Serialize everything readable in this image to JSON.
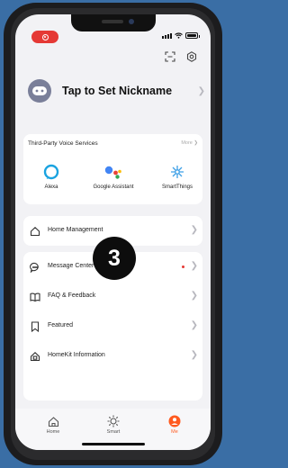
{
  "profile": {
    "nickname": "Tap to Set Nickname"
  },
  "voice": {
    "title": "Third-Party Voice Services",
    "more": "More",
    "services": [
      {
        "label": "Alexa",
        "icon": "alexa-icon"
      },
      {
        "label": "Google Assistant",
        "icon": "google-assistant-icon"
      },
      {
        "label": "SmartThings",
        "icon": "smartthings-icon"
      }
    ]
  },
  "menu": {
    "home_management": "Home Management",
    "message_center": "Message Center",
    "faq": "FAQ & Feedback",
    "featured": "Featured",
    "homekit": "HomeKit Information"
  },
  "step_badge": "3",
  "tabs": [
    {
      "label": "Home",
      "icon": "home-icon",
      "active": false
    },
    {
      "label": "Smart",
      "icon": "sun-icon",
      "active": false
    },
    {
      "label": "Me",
      "icon": "profile-icon",
      "active": true
    }
  ],
  "colors": {
    "accent": "#ff5a1f",
    "record": "#e53935",
    "background": "#3a6ea5"
  }
}
